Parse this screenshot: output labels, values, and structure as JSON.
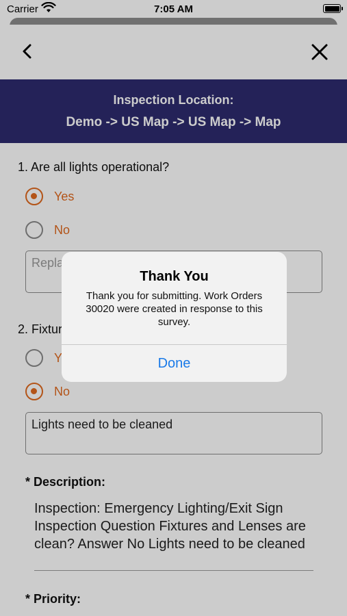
{
  "status_bar": {
    "carrier": "Carrier",
    "time": "7:05 AM"
  },
  "header": {
    "location_label": "Inspection Location:",
    "location_path": "Demo -> US Map -> US Map -> Map"
  },
  "questions": [
    {
      "text": "1. Are all lights operational?",
      "options": [
        {
          "label": "Yes",
          "selected": true
        },
        {
          "label": "No",
          "selected": false
        }
      ],
      "comment_placeholder": "Replace"
    },
    {
      "text": "2. Fixtures and Lenses are clean?",
      "options": [
        {
          "label": "Yes",
          "selected": false
        },
        {
          "label": "No",
          "selected": true
        }
      ],
      "comment_value": "Lights need to be cleaned"
    }
  ],
  "form": {
    "description_label": "* Description:",
    "description_value": "Inspection: Emergency Lighting/Exit Sign Inspection Question Fixtures and Lenses are clean? Answer No Lights need to be cleaned",
    "priority_label": "* Priority:"
  },
  "alert": {
    "title": "Thank You",
    "message": "Thank you for submitting. Work Orders 30020 were created in response to this survey.",
    "button_label": "Done"
  },
  "colors": {
    "accent": "#e06a1f",
    "banner": "#2d2b6e",
    "link": "#1a7ae8"
  }
}
